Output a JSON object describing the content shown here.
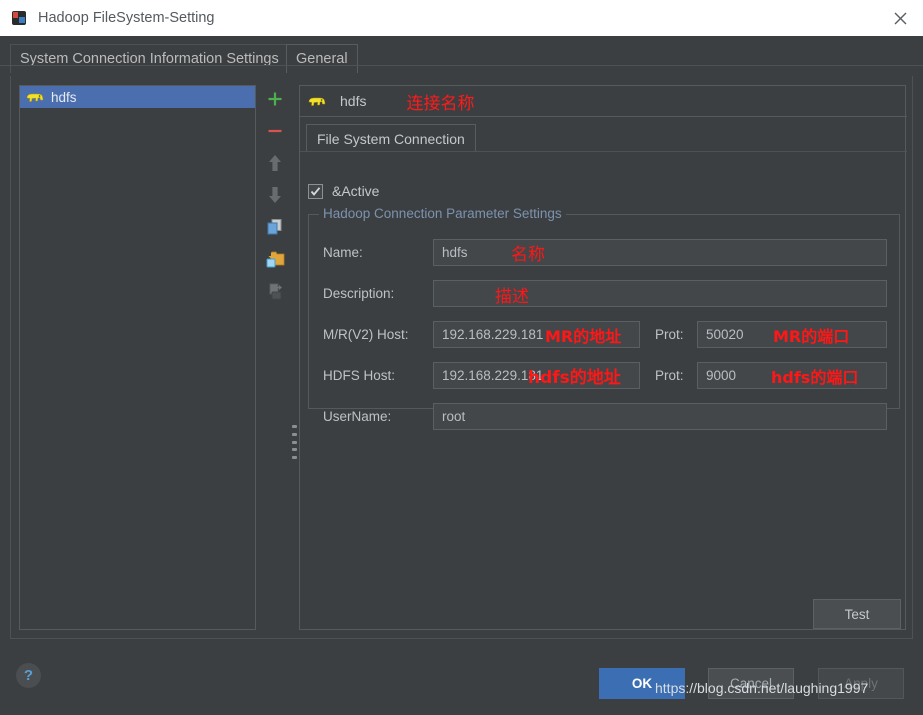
{
  "window": {
    "title": "Hadoop FileSystem-Setting",
    "icon": "intellij-app-icon",
    "close_label": "close-icon"
  },
  "tabs": [
    {
      "label": "System Connection Information Settings",
      "active": true
    },
    {
      "label": "General",
      "active": false
    }
  ],
  "left_panel": {
    "items": [
      {
        "label": "hdfs",
        "icon": "hadoop-elephant-icon",
        "selected": true
      }
    ]
  },
  "toolbar": {
    "buttons": [
      {
        "name": "add-button",
        "icon": "plus-icon",
        "enabled": true
      },
      {
        "name": "remove-button",
        "icon": "minus-icon",
        "enabled": true
      },
      {
        "name": "move-up-button",
        "icon": "arrow-up-icon",
        "enabled": false
      },
      {
        "name": "move-down-button",
        "icon": "arrow-down-icon",
        "enabled": false
      },
      {
        "name": "copy-button",
        "icon": "copy-icon",
        "enabled": true
      },
      {
        "name": "import-button",
        "icon": "import-folder-icon",
        "enabled": true
      },
      {
        "name": "export-button",
        "icon": "export-icon",
        "enabled": false
      }
    ]
  },
  "right_panel": {
    "header_name": "hdfs",
    "header_icon": "hadoop-elephant-icon",
    "header_annotation": "连接名称",
    "subtab": "File System Connection",
    "active_checkbox": {
      "label": "&Active",
      "checked": true
    },
    "group_title": "Hadoop Connection Parameter Settings",
    "fields": [
      {
        "label": "Name:",
        "value": "hdfs",
        "annotation": "名称",
        "placeholder": ""
      },
      {
        "label": "Description:",
        "value": "",
        "annotation": "描述",
        "placeholder": ""
      },
      {
        "label": "M/R(V2) Host:",
        "value": "192.168.229.181",
        "annotation": "MR的地址",
        "placeholder": ""
      },
      {
        "label": "HDFS Host:",
        "value": "192.168.229.181",
        "annotation": "hdfs的地址",
        "placeholder": ""
      },
      {
        "label": "UserName:",
        "value": "root",
        "annotation": "",
        "placeholder": ""
      }
    ],
    "ports": [
      {
        "label": "Prot:",
        "value": "50020",
        "annotation": "MR的端口"
      },
      {
        "label": "Prot:",
        "value": "9000",
        "annotation": "hdfs的端口"
      }
    ],
    "test_button": "Test"
  },
  "footer": {
    "help": "?",
    "ok": "OK",
    "cancel": "Cancel",
    "apply": "Apply"
  },
  "watermark": "https://blog.csdn.net/laughing1997",
  "colors": {
    "window_bg": "#3c3f41",
    "titlebar_bg": "#ffffff",
    "selection_blue": "#4b6eaf",
    "ok_blue": "#3c6eb4",
    "annotation_red": "#ff1616",
    "group_title_blue": "#7c92ad",
    "elephant_yellow": "#f2e02a"
  }
}
